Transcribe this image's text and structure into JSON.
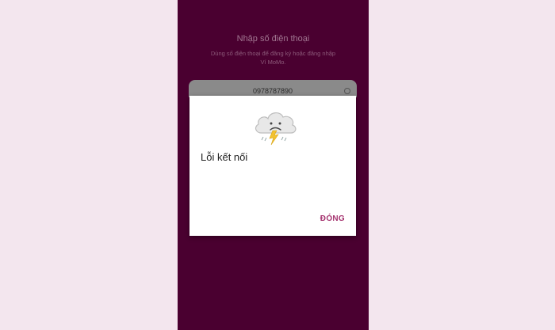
{
  "login": {
    "title": "Nhập số điện thoại",
    "subtitle": "Dùng số điện thoại để đăng ký hoặc đăng nhập Ví MoMo.",
    "phone_value": "0978787890"
  },
  "dialog": {
    "icon": "cloud-storm-sad-icon",
    "title": "Lỗi kết nối",
    "close_label": "ĐÓNG"
  },
  "colors": {
    "background": "#f3e6ee",
    "app_background": "#4a0030",
    "accent": "#a5336f"
  }
}
